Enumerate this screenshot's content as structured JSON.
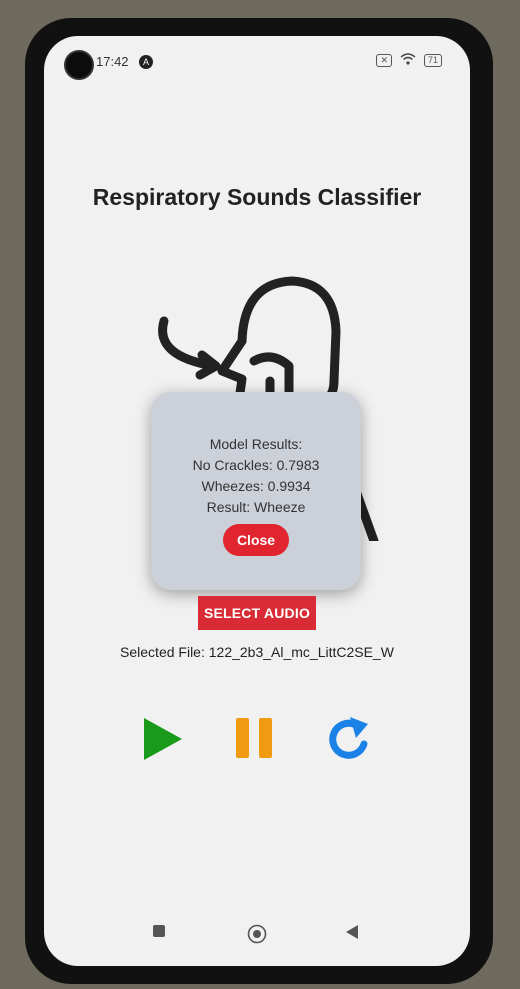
{
  "status_bar": {
    "time": "17:42",
    "notification_badge": "A",
    "battery": "71"
  },
  "app": {
    "title": "Respiratory Sounds Classifier"
  },
  "dialog": {
    "heading": "Model Results:",
    "crackles": "No Crackles: 0.7983",
    "wheezes": "Wheezes: 0.9934",
    "result": "Result: Wheeze",
    "close_label": "Close"
  },
  "actions": {
    "select_audio_label": "SELECT AUDIO"
  },
  "selected_file": "Selected File: 122_2b3_Al_mc_LittC2SE_W",
  "controls": {
    "play_icon": "play-icon",
    "pause_icon": "pause-icon",
    "replay_icon": "replay-icon"
  },
  "colors": {
    "accent_red": "#d82b35",
    "play_green": "#1a9a1a",
    "pause_orange": "#f09a12",
    "replay_blue": "#1a82e6"
  }
}
